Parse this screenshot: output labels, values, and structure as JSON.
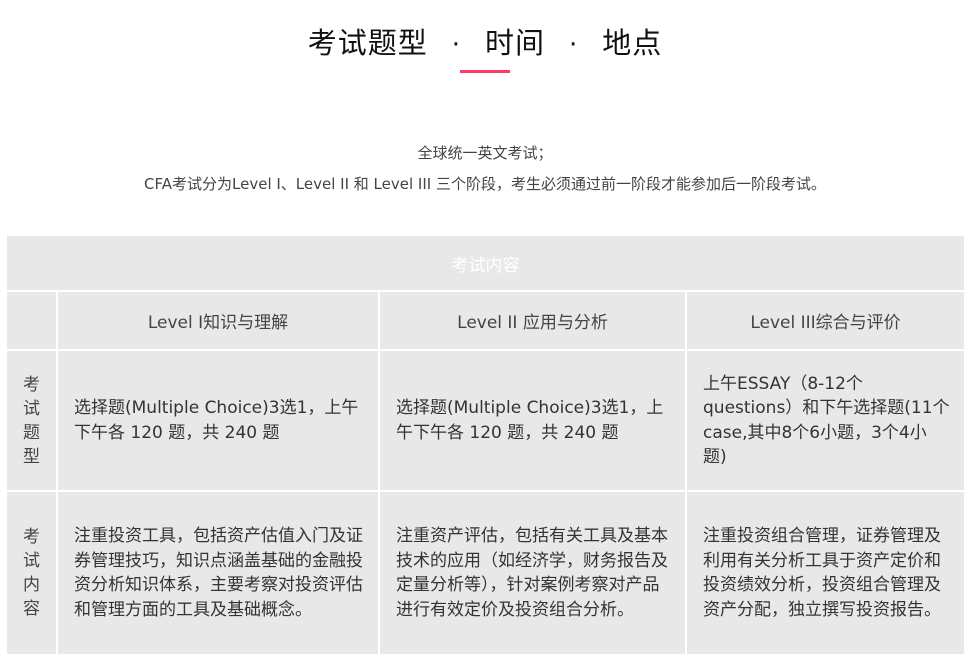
{
  "header": {
    "title_parts": [
      "考试题型",
      "时间",
      "地点"
    ],
    "separator": "·"
  },
  "intro": {
    "line1": "全球统一英文考试；",
    "line2": "CFA考试分为Level I、Level II 和 Level III 三个阶段，考生必须通过前一阶段才能参加后一阶段考试。"
  },
  "table": {
    "header": "考试内容",
    "levels": [
      "Level I知识与理解",
      "Level II 应用与分析",
      "Level III综合与评价"
    ],
    "rows": [
      {
        "label_chars": [
          "考",
          "试",
          "题",
          "型"
        ],
        "cells": [
          "选择题(Multiple Choice)3选1，上午下午各 120 题，共 240 题",
          "选择题(Multiple Choice)3选1，上午下午各 120 题，共 240 题",
          "上午ESSAY（8-12个questions）和下午选择题(11个case,其中8个6小题，3个4小题)"
        ]
      },
      {
        "label_chars": [
          "考",
          "试",
          "内",
          "容"
        ],
        "cells": [
          "注重投资工具，包括资产估值入门及证券管理技巧，知识点涵盖基础的金融投资分析知识体系，主要考察对投资评估和管理方面的工具及基础概念。",
          "注重资产评估，包括有关工具及基本技术的应用（如经济学，财务报告及定量分析等），针对案例考察对产品进行有效定价及投资组合分析。",
          "注重投资组合管理，证券管理及利用有关分析工具于资产定价和投资绩效分析，投资组合管理及资产分配，独立撰写投资报告。"
        ]
      }
    ]
  },
  "colors": {
    "accent": "#ff3b65",
    "cell_bg": "#e8e8e8"
  }
}
